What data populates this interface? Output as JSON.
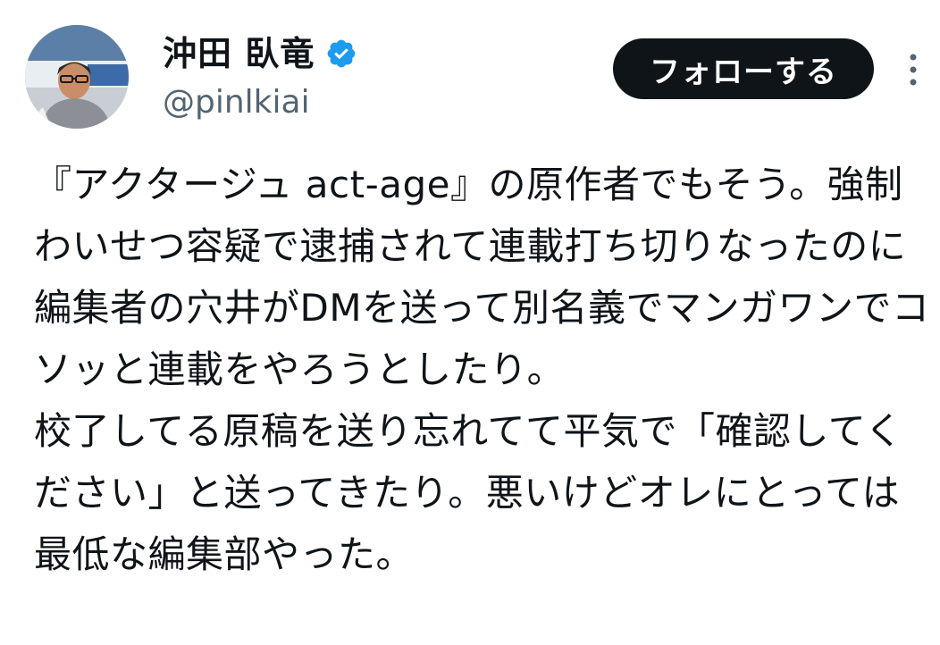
{
  "author": {
    "display_name": "沖田 臥竜",
    "handle": "@pinlkiai",
    "avatar_icon": "user-avatar",
    "verified_icon": "verified-badge-icon",
    "verified_color": "#1d9bf0"
  },
  "header": {
    "follow_label": "フォローする",
    "more_icon": "more-vertical-icon"
  },
  "tweet": {
    "text": "『アクタージュ act-age』の原作者でもそう。強制わいせつ容疑で逮捕されて連載打ち切りなったのに編集者の穴井がDMを送って別名義でマンガワンでコソッと連載をやろうとしたり。\n校了してる原稿を送り忘れてて平気で「確認してください」と送ってきたり。悪いけどオレにとっては最低な編集部やった。"
  },
  "colors": {
    "text": "#0f1419",
    "secondary_text": "#536471",
    "button_bg": "#0f1419",
    "button_text": "#ffffff",
    "accent": "#1d9bf0"
  }
}
